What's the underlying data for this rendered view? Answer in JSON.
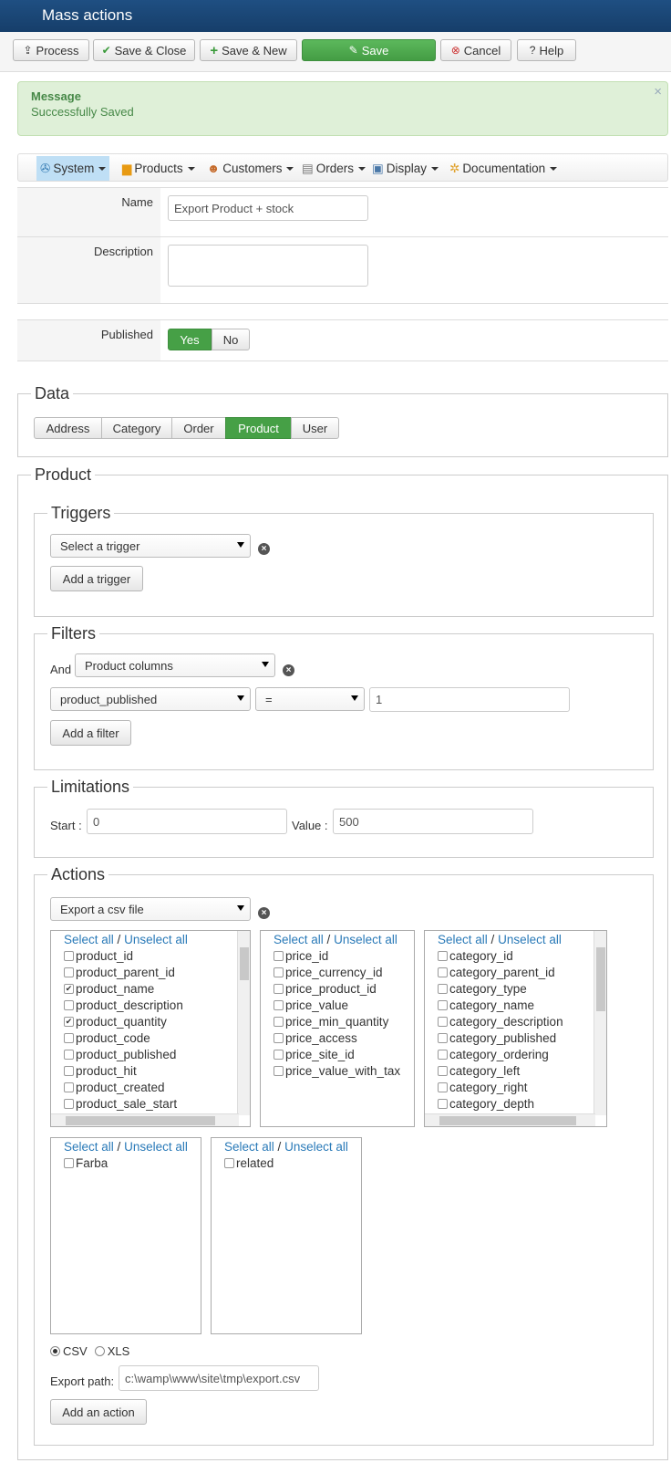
{
  "window": {
    "title": "Mass actions"
  },
  "toolbar": {
    "process": "Process",
    "save_close": "Save & Close",
    "save_new": "Save & New",
    "save": "Save",
    "cancel": "Cancel",
    "help": "Help"
  },
  "alert": {
    "title": "Message",
    "text": "Successfully Saved",
    "close": "×"
  },
  "menu": [
    "System",
    "Products",
    "Customers",
    "Orders",
    "Display",
    "Documentation"
  ],
  "form": {
    "name_label": "Name",
    "name_value": "Export Product + stock",
    "description_label": "Description",
    "description_value": "",
    "published_label": "Published",
    "yes": "Yes",
    "no": "No"
  },
  "data_section": {
    "legend": "Data",
    "tabs": [
      "Address",
      "Category",
      "Order",
      "Product",
      "User"
    ],
    "active": "Product"
  },
  "product_legend": "Product",
  "triggers": {
    "legend": "Triggers",
    "select": "Select a trigger",
    "add": "Add a trigger"
  },
  "filters": {
    "legend": "Filters",
    "and": "And",
    "type": "Product columns",
    "column": "product_published",
    "operator": "=",
    "value": "1",
    "add": "Add a filter"
  },
  "limitations": {
    "legend": "Limitations",
    "start_label": "Start :",
    "start": "0",
    "value_label": "Value :",
    "value": "500"
  },
  "actions": {
    "legend": "Actions",
    "select": "Export a csv file",
    "select_all": "Select all",
    "sep": "/",
    "unselect_all": "Unselect all",
    "product_cols": [
      {
        "name": "product_id",
        "checked": false
      },
      {
        "name": "product_parent_id",
        "checked": false
      },
      {
        "name": "product_name",
        "checked": true
      },
      {
        "name": "product_description",
        "checked": false
      },
      {
        "name": "product_quantity",
        "checked": true
      },
      {
        "name": "product_code",
        "checked": false
      },
      {
        "name": "product_published",
        "checked": false
      },
      {
        "name": "product_hit",
        "checked": false
      },
      {
        "name": "product_created",
        "checked": false
      },
      {
        "name": "product_sale_start",
        "checked": false
      }
    ],
    "price_cols": [
      "price_id",
      "price_currency_id",
      "price_product_id",
      "price_value",
      "price_min_quantity",
      "price_access",
      "price_site_id",
      "price_value_with_tax"
    ],
    "category_cols": [
      "category_id",
      "category_parent_id",
      "category_type",
      "category_name",
      "category_description",
      "category_published",
      "category_ordering",
      "category_left",
      "category_right",
      "category_depth"
    ],
    "custom_cols": [
      "Farba"
    ],
    "related_cols": [
      "related"
    ],
    "format_csv": "CSV",
    "format_xls": "XLS",
    "format_selected": "CSV",
    "export_path_label": "Export path:",
    "export_path": "c:\\wamp\\www\\site\\tmp\\export.csv",
    "add": "Add an action"
  }
}
